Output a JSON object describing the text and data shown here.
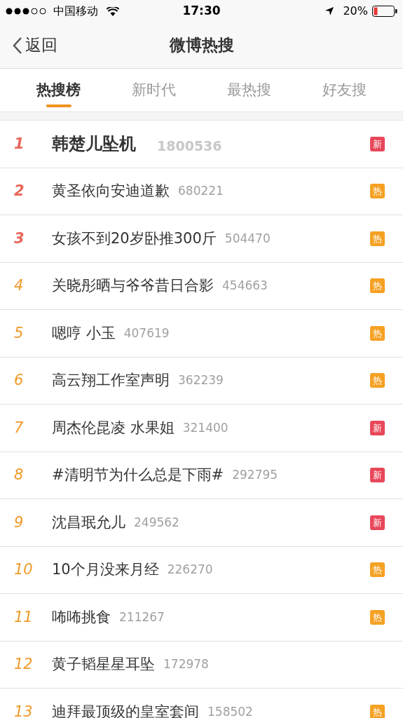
{
  "status_bar": {
    "carrier": "中国移动",
    "time": "17:30",
    "battery": "20%"
  },
  "nav": {
    "back": "返回",
    "title": "微博热搜"
  },
  "tabs": [
    {
      "label": "热搜榜",
      "selected": true
    },
    {
      "label": "新时代",
      "selected": false
    },
    {
      "label": "最热搜",
      "selected": false
    },
    {
      "label": "好友搜",
      "selected": false
    }
  ],
  "items": [
    {
      "rank": "1",
      "title": "韩楚儿坠机",
      "count": "1800536",
      "featured": true,
      "color": "#e8675a",
      "badge": {
        "kind": "new",
        "text": "新"
      }
    },
    {
      "rank": "2",
      "title": "黄圣依向安迪道歉",
      "count": "680221",
      "featured": false,
      "color": "#e8675a",
      "badge": {
        "kind": "hot",
        "text": "热"
      }
    },
    {
      "rank": "3",
      "title": "女孩不到20岁卧推300斤",
      "count": "504470",
      "featured": false,
      "color": "#e8675a",
      "badge": {
        "kind": "hot",
        "text": "热"
      }
    },
    {
      "rank": "4",
      "title": "关晓彤晒与爷爷昔日合影",
      "count": "454663",
      "featured": false,
      "color": "#f09a2a",
      "badge": {
        "kind": "hot",
        "text": "热"
      }
    },
    {
      "rank": "5",
      "title": "嗯哼 小玉",
      "count": "407619",
      "featured": false,
      "color": "#f09a2a",
      "badge": {
        "kind": "hot",
        "text": "热"
      }
    },
    {
      "rank": "6",
      "title": "高云翔工作室声明",
      "count": "362239",
      "featured": false,
      "color": "#f09a2a",
      "badge": {
        "kind": "hot",
        "text": "热"
      }
    },
    {
      "rank": "7",
      "title": "周杰伦昆凌 水果姐",
      "count": "321400",
      "featured": false,
      "color": "#f09a2a",
      "badge": {
        "kind": "new",
        "text": "新"
      }
    },
    {
      "rank": "8",
      "title": "#清明节为什么总是下雨#",
      "count": "292795",
      "featured": false,
      "color": "#f09a2a",
      "badge": {
        "kind": "new",
        "text": "新"
      }
    },
    {
      "rank": "9",
      "title": "沈昌珉允儿",
      "count": "249562",
      "featured": false,
      "color": "#f09a2a",
      "badge": {
        "kind": "new",
        "text": "新"
      }
    },
    {
      "rank": "10",
      "title": "10个月没来月经",
      "count": "226270",
      "featured": false,
      "color": "#f09a2a",
      "badge": {
        "kind": "hot",
        "text": "热"
      }
    },
    {
      "rank": "11",
      "title": "咘咘挑食",
      "count": "211267",
      "featured": false,
      "color": "#f09a2a",
      "badge": {
        "kind": "hot",
        "text": "热"
      }
    },
    {
      "rank": "12",
      "title": "黄子韬星星耳坠",
      "count": "172978",
      "featured": false,
      "color": "#f09a2a"
    },
    {
      "rank": "13",
      "title": "迪拜最顶级的皇室套间",
      "count": "158502",
      "featured": false,
      "color": "#f09a2a",
      "badge": {
        "kind": "hot",
        "text": "热"
      }
    }
  ]
}
